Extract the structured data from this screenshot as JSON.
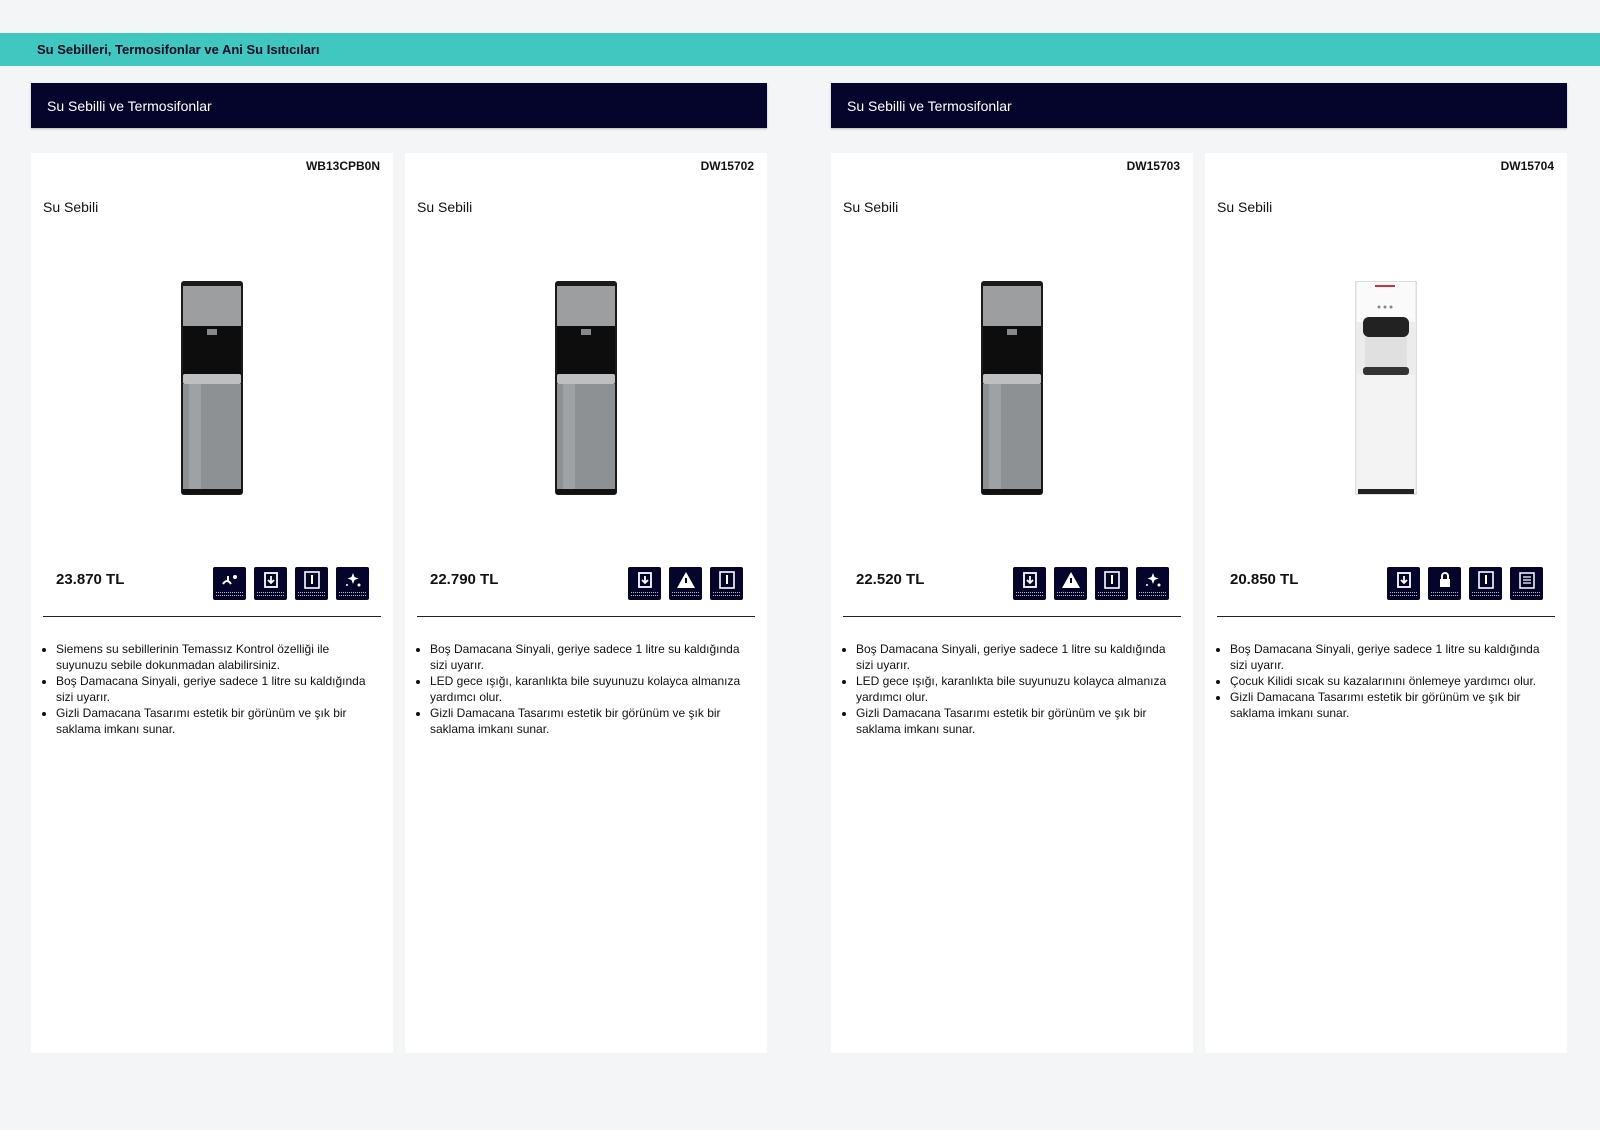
{
  "header": {
    "title": "Su Sebilleri, Termosifonlar ve Ani Su Isıtıcıları"
  },
  "sections": [
    {
      "title": "Su Sebilli ve Termosifonlar"
    },
    {
      "title": "Su Sebilli ve Termosifonlar"
    }
  ],
  "products": [
    {
      "code": "WB13CPB0N",
      "type": "Su Sebili",
      "price": "23.870 TL",
      "color": "steel",
      "icons": [
        "touchless-control-icon",
        "empty-bottle-signal-icon",
        "hidden-bottle-icon",
        "self-cleaning-icon"
      ],
      "features": [
        "Siemens su sebillerinin Temassız Kontrol özelliği ile suyunuzu sebile dokunmadan alabilirsiniz.",
        "Boş Damacana Sinyali, geriye sadece 1 litre su kaldığında sizi uyarır.",
        "Gizli Damacana Tasarımı estetik bir görünüm ve şık bir saklama imkanı sunar."
      ]
    },
    {
      "code": "DW15702",
      "type": "Su Sebili",
      "price": "22.790 TL",
      "color": "steel",
      "icons": [
        "empty-bottle-signal-icon",
        "led-night-light-icon",
        "hidden-bottle-icon"
      ],
      "features": [
        "Boş Damacana Sinyali, geriye sadece 1 litre su kaldığında sizi uyarır.",
        "LED gece ışığı, karanlıkta bile suyunuzu kolayca almanıza yardımcı olur.",
        "Gizli Damacana Tasarımı estetik bir görünüm ve şık bir saklama imkanı sunar."
      ]
    },
    {
      "code": "DW15703",
      "type": "Su Sebili",
      "price": "22.520 TL",
      "color": "steel",
      "icons": [
        "empty-bottle-signal-icon",
        "led-night-light-icon",
        "hidden-bottle-icon",
        "self-cleaning-icon"
      ],
      "features": [
        "Boş Damacana Sinyali, geriye sadece 1 litre su kaldığında sizi uyarır.",
        "LED gece ışığı, karanlıkta bile suyunuzu kolayca almanıza yardımcı olur.",
        "Gizli Damacana Tasarımı estetik bir görünüm ve şık bir saklama imkanı sunar."
      ]
    },
    {
      "code": "DW15704",
      "type": "Su Sebili",
      "price": "20.850 TL",
      "color": "white",
      "icons": [
        "empty-bottle-signal-icon",
        "child-lock-icon",
        "hidden-bottle-icon",
        "hot-water-icon"
      ],
      "features": [
        "Boş Damacana Sinyali, geriye sadece 1 litre su kaldığında sizi uyarır.",
        "Çocuk Kilidi sıcak su kazalarınını önlemeye yardımcı olur.",
        "Gizli Damacana Tasarımı estetik bir görünüm ve şık bir saklama imkanı sunar."
      ]
    }
  ]
}
